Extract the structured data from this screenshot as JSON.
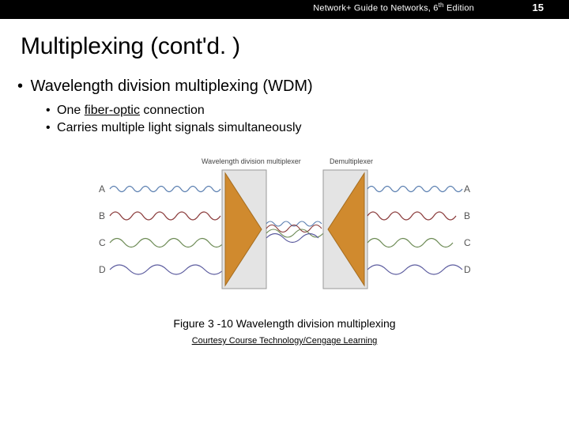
{
  "header": {
    "source_prefix": "Network+ Guide to Networks, 6",
    "source_suffix": " Edition",
    "source_sup": "th",
    "page_number": "15"
  },
  "title": "Multiplexing (cont'd. )",
  "bullets": {
    "l1": "Wavelength division multiplexing (WDM)",
    "l2a_pre": "One ",
    "l2a_link": "fiber-optic",
    "l2a_post": " connection",
    "l2b": "Carries multiple light signals simultaneously"
  },
  "diagram": {
    "mux_label": "Wavelength division multiplexer",
    "demux_label": "Demultiplexer",
    "left_labels": [
      "A",
      "B",
      "C",
      "D"
    ],
    "right_labels": [
      "A",
      "B",
      "C",
      "D"
    ],
    "colors": {
      "A": "#5b7fb0",
      "B": "#8a3a3a",
      "C": "#6c8a54",
      "D": "#5b5b9e"
    }
  },
  "caption": "Figure 3 -10 Wavelength division multiplexing",
  "credit": "Courtesy Course Technology/Cengage Learning"
}
